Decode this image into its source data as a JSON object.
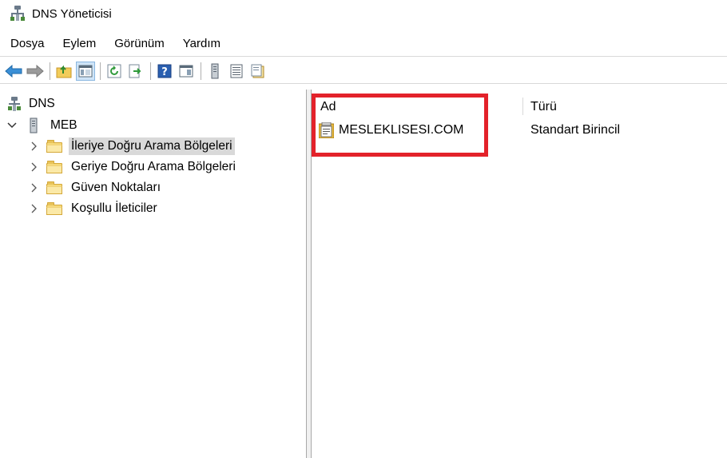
{
  "window": {
    "title": "DNS Yöneticisi"
  },
  "menu": {
    "items": [
      "Dosya",
      "Eylem",
      "Görünüm",
      "Yardım"
    ]
  },
  "toolbar": {
    "buttons": [
      "back-icon",
      "forward-icon",
      "up-folder-icon",
      "show-hide-tree-icon",
      "refresh-icon",
      "export-list-icon",
      "help-icon",
      "properties-pane-icon",
      "server-icon",
      "list-view-icon",
      "new-zone-icon"
    ]
  },
  "tree": {
    "root": "DNS",
    "server": "MEB",
    "children": [
      {
        "label": "İleriye Doğru Arama Bölgeleri",
        "selected": true
      },
      {
        "label": "Geriye Doğru Arama Bölgeleri",
        "selected": false
      },
      {
        "label": "Güven Noktaları",
        "selected": false
      },
      {
        "label": "Koşullu İleticiler",
        "selected": false
      }
    ]
  },
  "list": {
    "columns": [
      "Ad",
      "Türü"
    ],
    "rows": [
      {
        "name": "MESLEKLISESI.COM",
        "type": "Standart Birincil"
      }
    ]
  },
  "colors": {
    "highlight": "#e3222a",
    "selection": "#d9d9d9",
    "folder": "#f6d97a"
  }
}
